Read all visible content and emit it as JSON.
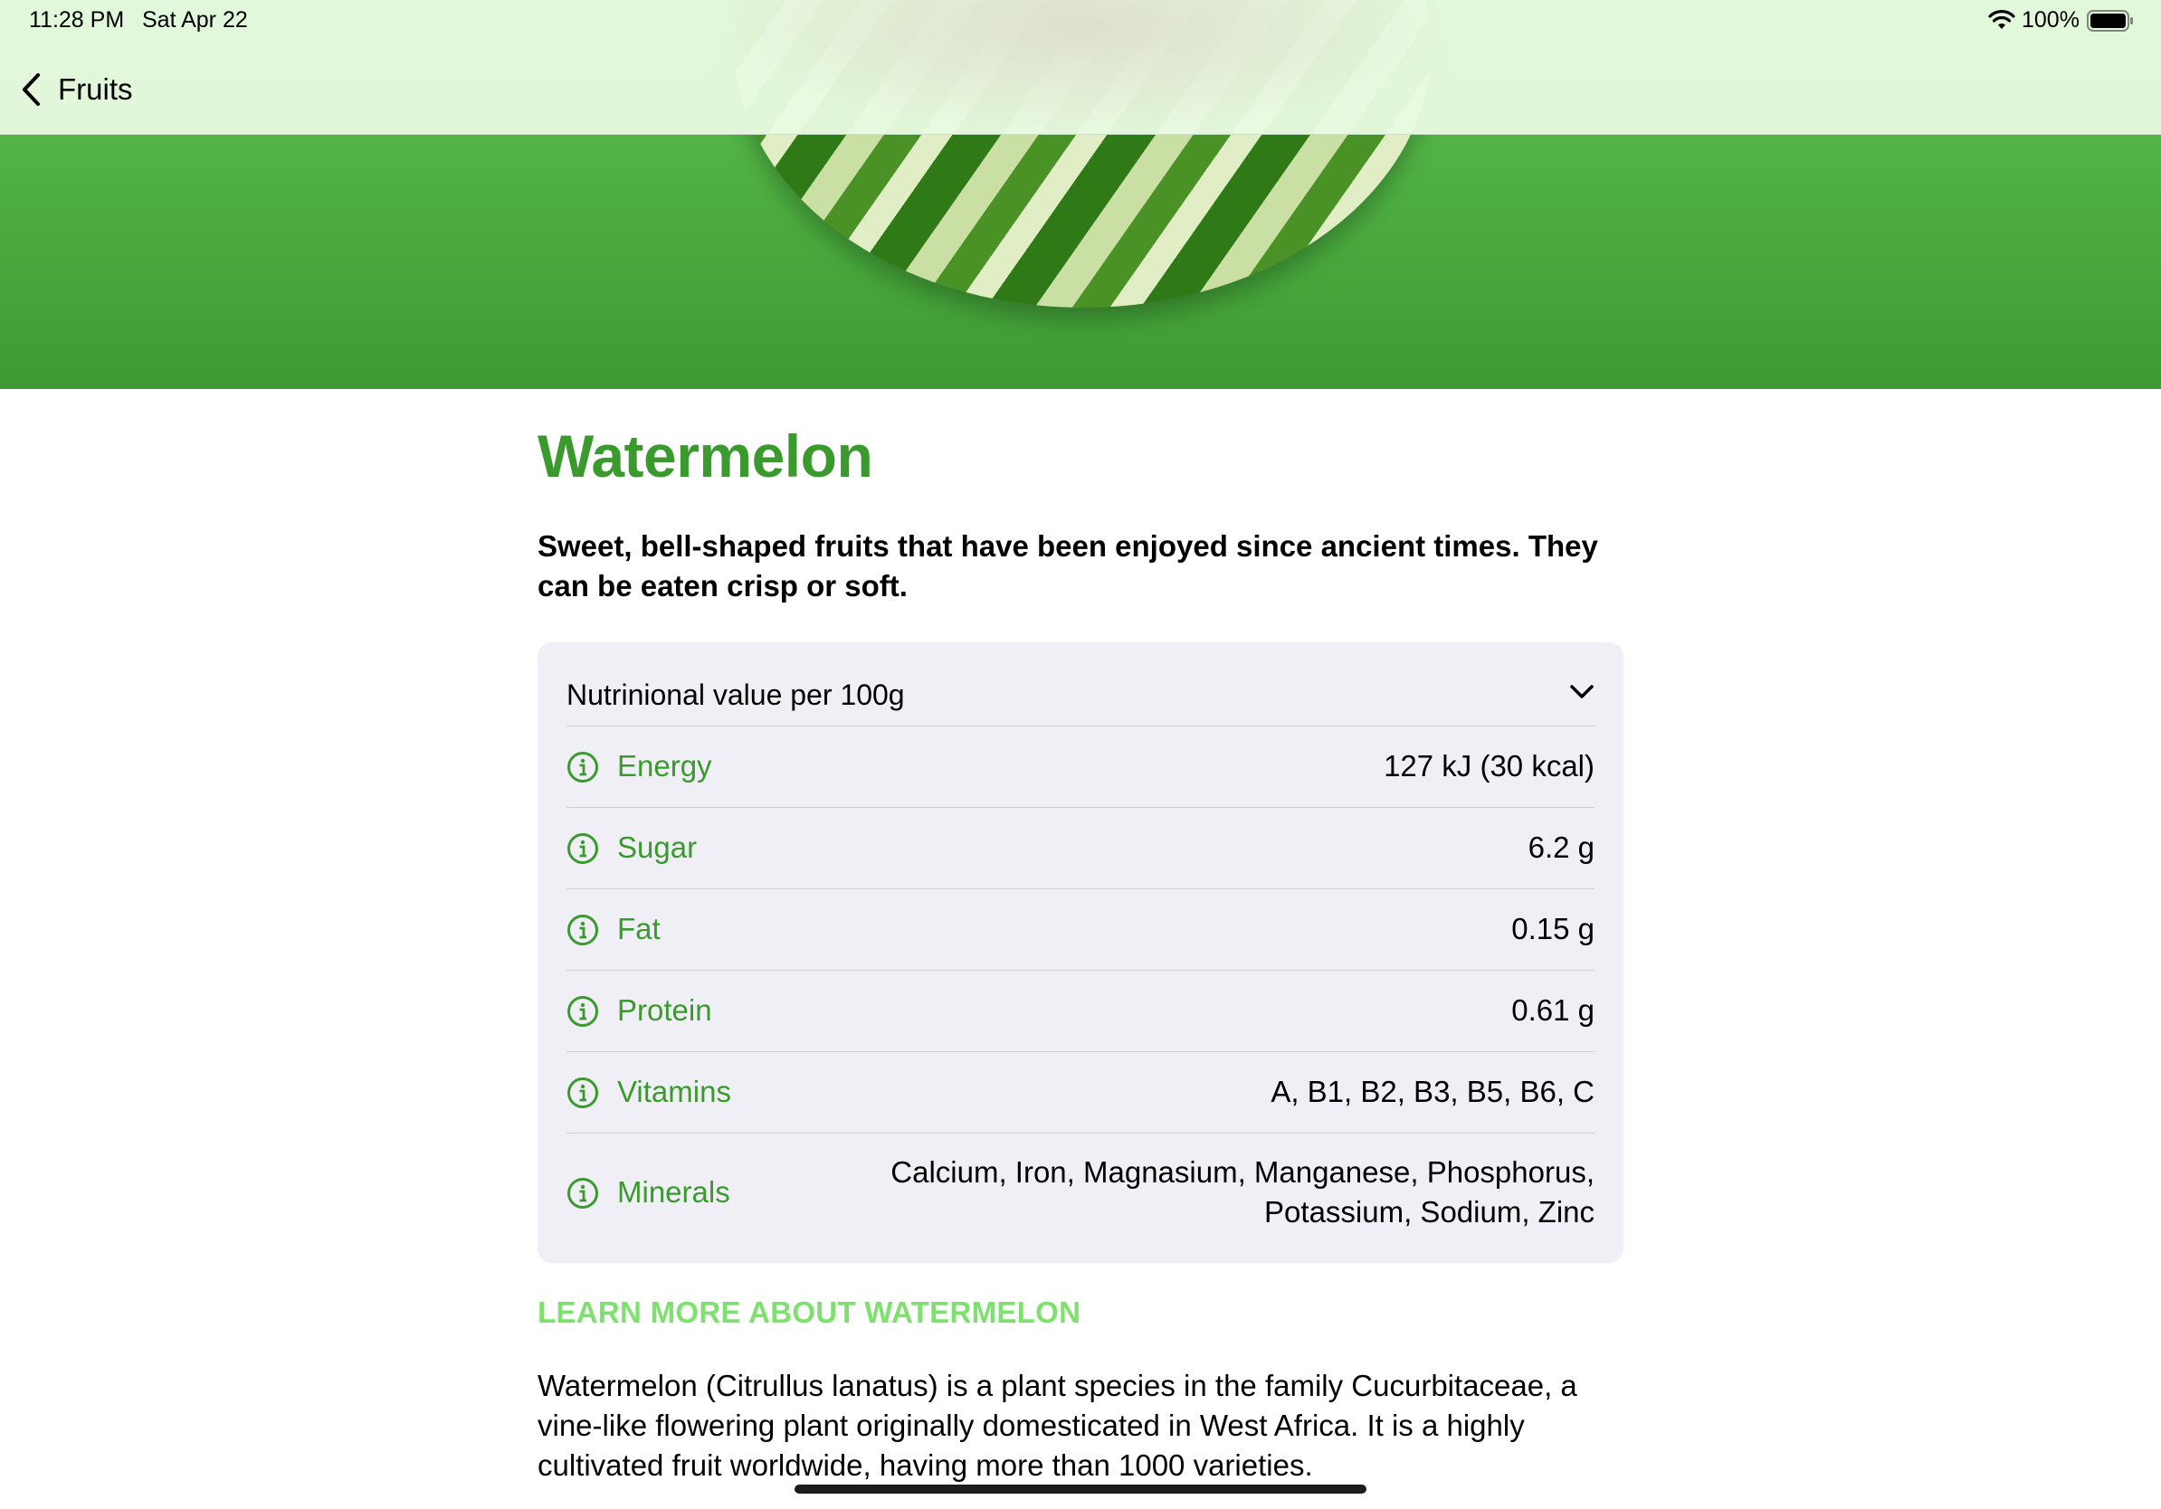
{
  "status_bar": {
    "time": "11:28 PM",
    "date": "Sat Apr 22",
    "battery": "100%",
    "icons": [
      "wifi-icon",
      "battery-icon"
    ]
  },
  "nav": {
    "back_label": "Fruits",
    "back_icon": "chevron-left-icon"
  },
  "hero": {
    "image": "watermelon-image"
  },
  "fruit": {
    "title": "Watermelon",
    "subtitle": "Sweet, bell-shaped fruits that have been enjoyed since ancient times. They can be eaten crisp or soft."
  },
  "nutrition": {
    "header": "Nutrinional value per 100g",
    "expand_icon": "chevron-down-icon",
    "rows": [
      {
        "label": "Energy",
        "value": "127 kJ (30 kcal)",
        "icon": "info-icon"
      },
      {
        "label": "Sugar",
        "value": "6.2 g",
        "icon": "info-icon"
      },
      {
        "label": "Fat",
        "value": "0.15 g",
        "icon": "info-icon"
      },
      {
        "label": "Protein",
        "value": "0.61 g",
        "icon": "info-icon"
      },
      {
        "label": "Vitamins",
        "value": "A, B1, B2, B3, B5, B6, C",
        "icon": "info-icon"
      },
      {
        "label": "Minerals",
        "value": "Calcium, Iron, Magnasium, Manganese, Phosphorus, Potassium, Sodium, Zinc",
        "icon": "info-icon"
      }
    ]
  },
  "learn_more": {
    "heading": "LEARN MORE ABOUT WATERMELON",
    "text": "Watermelon (Citrullus lanatus) is a plant species in the family Cucurbitaceae, a vine-like flowering plant originally domesticated in West Africa. It is a highly cultivated fruit worldwide, having more than 1000 varieties."
  },
  "colors": {
    "accent": "#3a9a2e",
    "learn_more": "#7ee06e",
    "hero_top": "#5dc24f",
    "hero_bottom": "#3d9a32",
    "card_bg": "#f0eff5"
  }
}
